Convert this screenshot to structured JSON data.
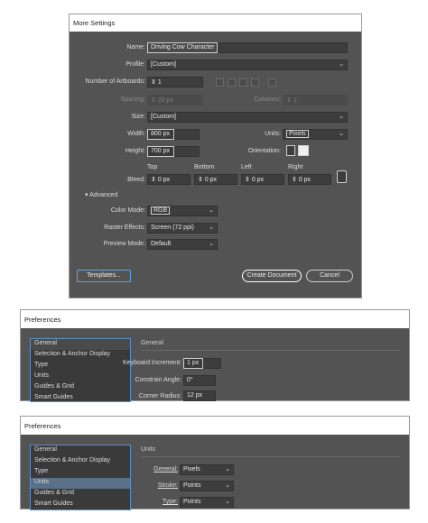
{
  "dialog1": {
    "title": "More Settings",
    "name_label": "Name:",
    "name_value": "Driving Cow Character",
    "profile_label": "Profile:",
    "profile_value": "[Custom]",
    "artboards_label": "Number of Artboards:",
    "artboards_value": "1",
    "spacing_label": "Spacing:",
    "spacing_value": "20 px",
    "columns_label": "Columns:",
    "columns_value": "1",
    "size_label": "Size:",
    "size_value": "[Custom]",
    "width_label": "Width:",
    "width_value": "800 px",
    "units_label": "Units:",
    "units_value": "Pixels",
    "height_label": "Height:",
    "height_value": "700 px",
    "orientation_label": "Orientation:",
    "bleed_label": "Bleed:",
    "bleed_top_label": "Top",
    "bleed_bottom_label": "Bottom",
    "bleed_left_label": "Left",
    "bleed_right_label": "Right",
    "bleed_top": "0 px",
    "bleed_bottom": "0 px",
    "bleed_left": "0 px",
    "bleed_right": "0 px",
    "advanced_label": "Advanced",
    "color_mode_label": "Color Mode:",
    "color_mode_value": "RGB",
    "raster_label": "Raster Effects:",
    "raster_value": "Screen (72 ppi)",
    "preview_label": "Preview Mode:",
    "preview_value": "Default",
    "templates_button": "Templates...",
    "create_button": "Create Document",
    "cancel_button": "Cancel"
  },
  "pref1": {
    "title": "Preferences",
    "sidebar": [
      "General",
      "Selection & Anchor Display",
      "Type",
      "Units",
      "Guides & Grid",
      "Smart Guides"
    ],
    "section": "General",
    "keyboard_label": "Keyboard Increment:",
    "keyboard_value": "1 px",
    "constrain_label": "Constrain Angle:",
    "constrain_value": "0°",
    "corner_label": "Corner Radius:",
    "corner_value": "12 px"
  },
  "pref2": {
    "title": "Preferences",
    "sidebar": [
      "General",
      "Selection & Anchor Display",
      "Type",
      "Units",
      "Guides & Grid",
      "Smart Guides"
    ],
    "section": "Units",
    "general_label": "General:",
    "general_value": "Pixels",
    "stroke_label": "Stroke:",
    "stroke_value": "Points",
    "type_label": "Type:",
    "type_value": "Points"
  }
}
